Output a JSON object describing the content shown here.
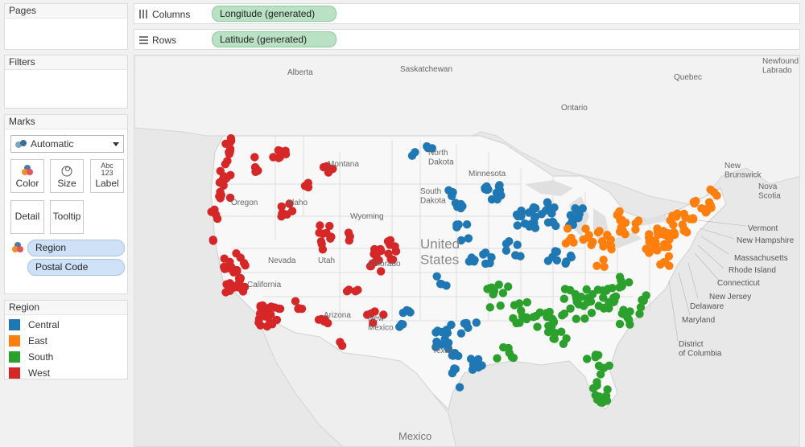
{
  "cards": {
    "pages": "Pages",
    "filters": "Filters",
    "marks": "Marks",
    "legend": "Region"
  },
  "marks": {
    "type": "Automatic",
    "buttons": {
      "color": "Color",
      "size": "Size",
      "label": "Label",
      "detail": "Detail",
      "tooltip": "Tooltip"
    },
    "label_icon_text": {
      "top": "Abc",
      "bottom": "123"
    },
    "fields": [
      "Region",
      "Postal Code"
    ]
  },
  "legend": {
    "items": [
      {
        "name": "Central",
        "color": "#1f77b4"
      },
      {
        "name": "East",
        "color": "#ff7f0e"
      },
      {
        "name": "South",
        "color": "#2ca02c"
      },
      {
        "name": "West",
        "color": "#d62728"
      }
    ]
  },
  "shelves": {
    "columns": {
      "label": "Columns",
      "pill": "Longitude (generated)"
    },
    "rows": {
      "label": "Rows",
      "pill": "Latitude (generated)"
    }
  },
  "map_labels": {
    "alberta": "Alberta",
    "saskatchewan": "Saskatchewan",
    "quebec": "Quebec",
    "ontario": "Ontario",
    "newfoundland": "Newfound\nLabrado",
    "north_dakota": "North\nDakota",
    "south_dakota": "South\nDakota",
    "minnesota": "Minnesota",
    "montana": "Montana",
    "idaho": "Idaho",
    "oregon": "Oregon",
    "wyoming": "Wyoming",
    "nevada": "Nevada",
    "utah": "Utah",
    "colorado": "Colorado",
    "california": "California",
    "arizona": "Arizona",
    "new_mexico": "New\nMexico",
    "texas": "Texas",
    "united_states": "United\nStates",
    "mexico": "Mexico",
    "new_brunswick": "New\nBrunswick",
    "nova_scotia": "Nova\nScotia",
    "vermont": "Vermont",
    "new_hampshire": "New Hampshire",
    "massachusetts": "Massachusetts",
    "rhode_island": "Rhode Island",
    "connecticut": "Connecticut",
    "new_jersey": "New Jersey",
    "delaware": "Delaware",
    "maryland": "Maryland",
    "district_of_columbia": "District\nof Columbia"
  },
  "colors": {
    "central": "#1f77b4",
    "east": "#ff7f0e",
    "south": "#2ca02c",
    "west": "#d62728",
    "pill_green": "#b9e1c3",
    "pill_blue": "#cfe1f6"
  }
}
